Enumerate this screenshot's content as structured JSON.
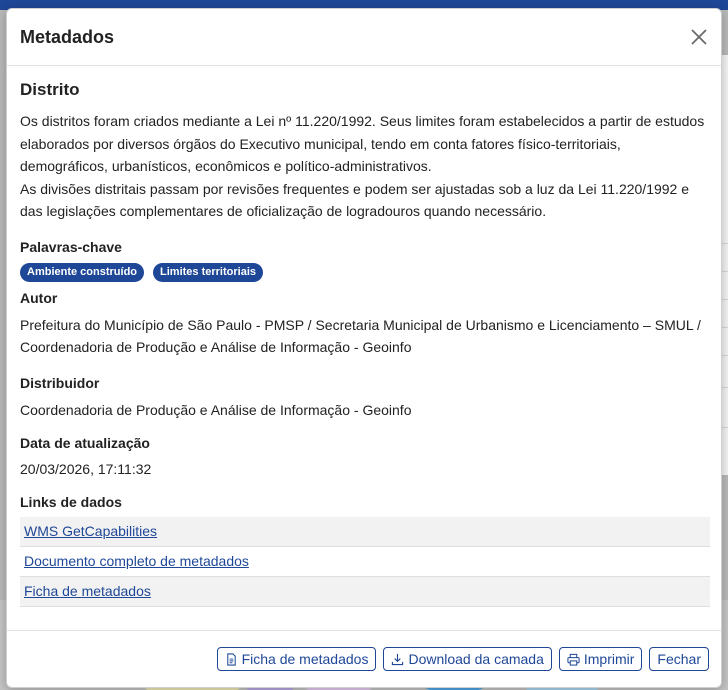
{
  "modal": {
    "title": "Metadados",
    "close_icon": "close-icon"
  },
  "layer": {
    "title": "Distrito",
    "description": [
      "Os distritos foram criados mediante a Lei nº 11.220/1992. Seus limites foram estabelecidos a partir de estudos elaborados por diversos órgãos do Executivo municipal, tendo em conta fatores físico-territoriais, demográficos, urbanísticos, econômicos e político-administrativos.",
      "As divisões distritais passam por revisões frequentes e podem ser ajustadas sob a luz da Lei 11.220/1992 e das legislações complementares de oficialização de logradouros quando necessário."
    ]
  },
  "keywords": {
    "label": "Palavras-chave",
    "items": [
      "Ambiente construído",
      "Limites territoriais"
    ]
  },
  "author": {
    "label": "Autor",
    "value": "Prefeitura do Município de São Paulo - PMSP / Secretaria Municipal de Urbanismo e Licenciamento – SMUL / Coordenadoria de Produção e Análise de Informação - Geoinfo"
  },
  "distributor": {
    "label": "Distribuidor",
    "value": "Coordenadoria de Produção e Análise de Informação - Geoinfo"
  },
  "updated": {
    "label": "Data de atualização",
    "value": "20/03/2026, 17:11:32"
  },
  "data_links": {
    "label": "Links de dados",
    "items": [
      "WMS GetCapabilities",
      "Documento completo de metadados",
      "Ficha de metadados"
    ]
  },
  "footer": {
    "ficha_label": "Ficha de metadados",
    "ficha_icon": "document-icon",
    "download_label": "Download da camada",
    "download_icon": "download-icon",
    "print_label": "Imprimir",
    "print_icon": "printer-icon",
    "close_label": "Fechar"
  },
  "colors": {
    "accent": "#1e4797",
    "link_row_alt": "#f2f2f2"
  }
}
